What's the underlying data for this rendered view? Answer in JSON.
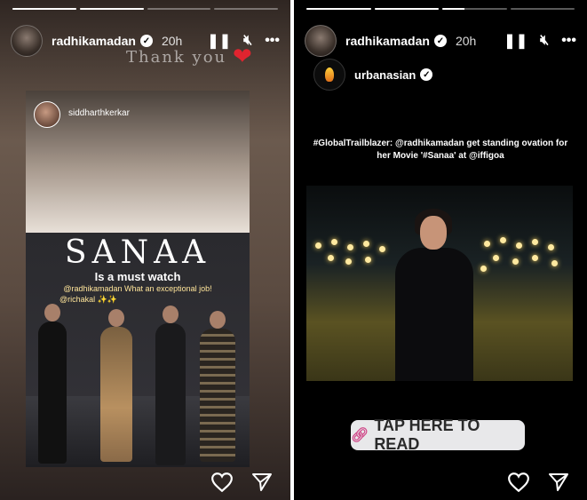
{
  "stories": {
    "left": {
      "progress": [
        1,
        1,
        0,
        0
      ],
      "username": "radhikamadan",
      "time": "20h",
      "overlay_text": "Thank you",
      "card": {
        "username": "siddharthkerkar",
        "title": "SANAA",
        "subtitle": "Is a must watch",
        "caption_line1": "@radhikamadan What an exceptional job!",
        "caption_line2": "@richakal ✨✨"
      }
    },
    "right": {
      "progress": [
        1,
        1,
        0.35,
        0
      ],
      "username": "radhikamadan",
      "time": "20h",
      "source_account": "urbanasian",
      "headline": "#GlobalTrailblazer: @radhikamadan get standing ovation for her Movie '#Sanaa' at @iffigoa",
      "cta_label": "TAP HERE TO READ"
    }
  },
  "icons": [
    "pause-icon",
    "mute-icon",
    "more-icon",
    "heart-icon",
    "share-icon",
    "verified-icon",
    "link-icon"
  ],
  "colors": {
    "heart": "#e0242f",
    "background_right": "#000000",
    "cta_bg": "#e8e8ea"
  }
}
